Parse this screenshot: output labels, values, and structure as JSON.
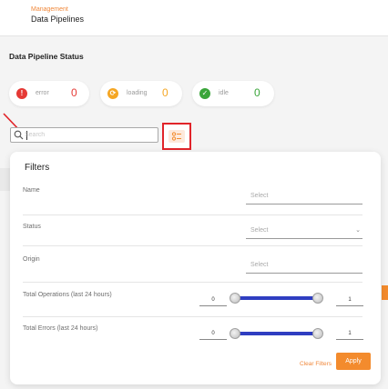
{
  "header": {
    "breadcrumb_parent": "Management",
    "title": "Data Pipelines"
  },
  "status_section": {
    "title": "Data Pipeline Status",
    "cards": [
      {
        "label": "error",
        "count": "0",
        "icon": "error-icon",
        "color": "#e53935"
      },
      {
        "label": "loading",
        "count": "0",
        "icon": "loading-icon",
        "color": "#f5a623"
      },
      {
        "label": "idle",
        "count": "0",
        "icon": "check-icon",
        "color": "#3aa53a"
      }
    ]
  },
  "search": {
    "placeholder": "Search",
    "value": ""
  },
  "filters": {
    "title": "Filters",
    "name": {
      "label": "Name",
      "placeholder": "Select"
    },
    "status": {
      "label": "Status",
      "placeholder": "Select"
    },
    "origin": {
      "label": "Origin",
      "placeholder": "Select"
    },
    "total_operations": {
      "label": "Total Operations (last 24 hours)",
      "min": "0",
      "max": "1",
      "range_low": 0,
      "range_high": 1
    },
    "total_errors": {
      "label": "Total Errors (last 24 hours)",
      "min": "0",
      "max": "1",
      "range_low": 0,
      "range_high": 1
    },
    "clear_label": "Clear Filters",
    "apply_label": "Apply"
  },
  "colors": {
    "accent": "#f38b2d",
    "slider": "#2f3ec1",
    "highlight": "#e1242a"
  }
}
